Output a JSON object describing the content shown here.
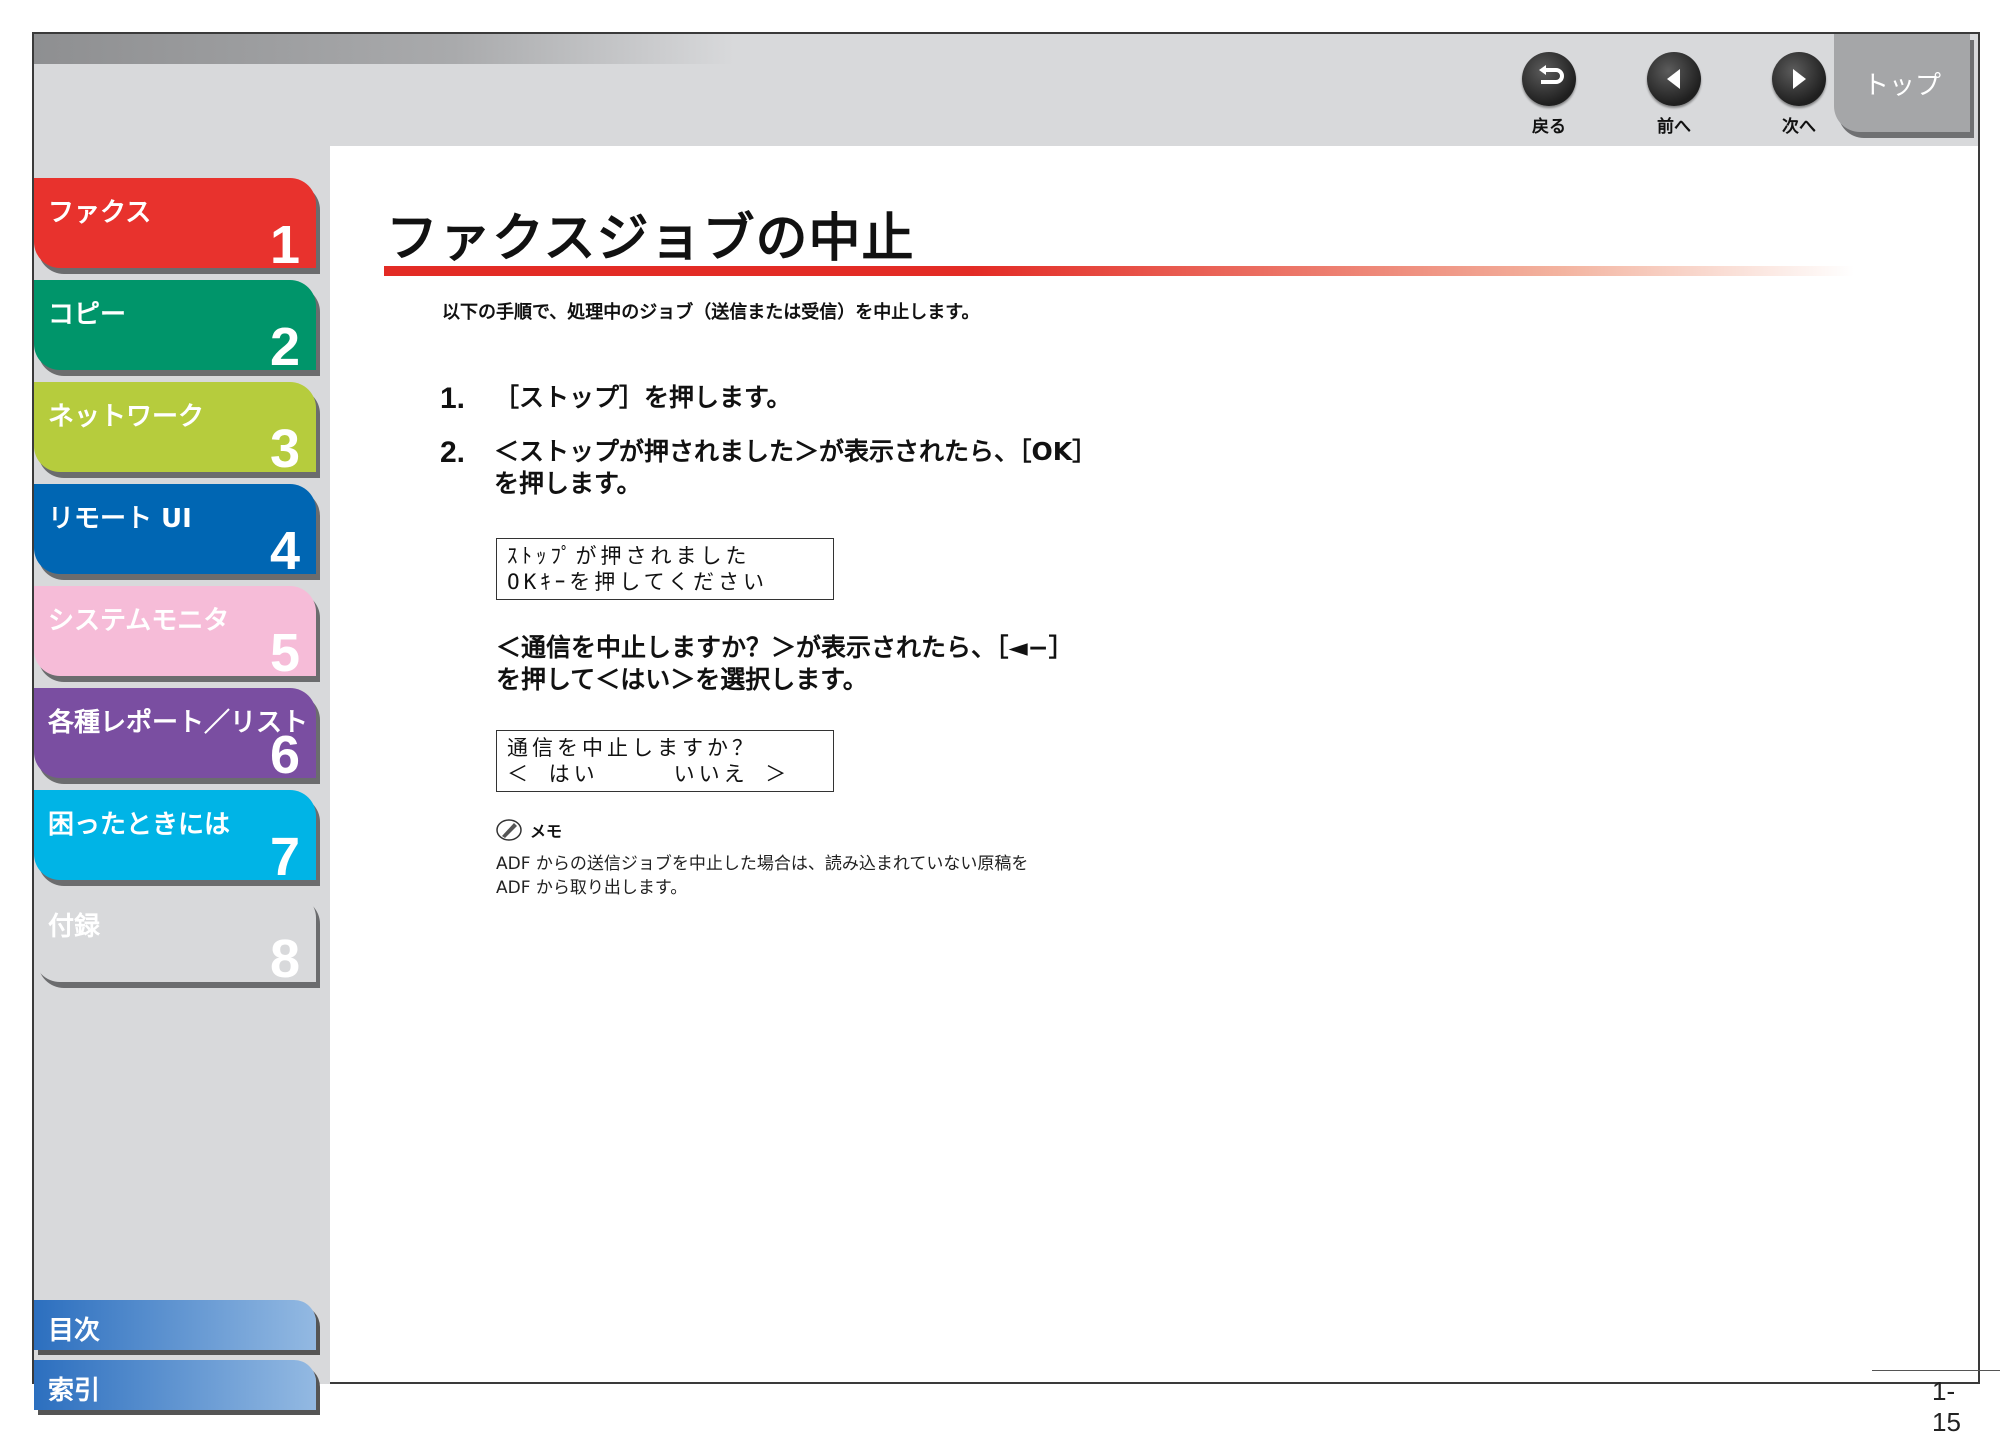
{
  "nav": {
    "back_label": "戻る",
    "prev_label": "前へ",
    "next_label": "次へ",
    "top_label": "トップ"
  },
  "chapters": [
    {
      "title": "ファクス",
      "number": "1",
      "color": "#e8322d"
    },
    {
      "title": "コピー",
      "number": "2",
      "color": "#00956a"
    },
    {
      "title": "ネットワーク",
      "number": "3",
      "color": "#b6cc3d"
    },
    {
      "title": "リモート UI",
      "number": "4",
      "color": "#0066b3"
    },
    {
      "title": "システムモニタ",
      "number": "5",
      "color": "#f6bcd8"
    },
    {
      "title": "各種レポート／リスト",
      "number": "6",
      "color": "#7a4ea1"
    },
    {
      "title": "困ったときには",
      "number": "7",
      "color": "#00b4e6"
    },
    {
      "title": "付録",
      "number": "8",
      "color": "#d8d9db"
    }
  ],
  "sidebar_bottom": {
    "contents_label": "目次",
    "index_label": "索引"
  },
  "page": {
    "title": "ファクスジョブの中止",
    "intro": "以下の手順で、処理中のジョブ（送信または受信）を中止します。",
    "steps": [
      {
        "number": "1.",
        "text": "［ストップ］を押します。"
      },
      {
        "number": "2.",
        "text_line1": "＜ストップが押されました＞が表示されたら、［OK］",
        "text_line2": "を押します。"
      }
    ],
    "lcd1": {
      "line1": "ｽﾄｯﾌﾟが押されました",
      "line2": "OKｷｰを押してください"
    },
    "substep": {
      "line1": "＜通信を中止しますか？＞が表示されたら、［◄−］",
      "line2": "を押して＜はい＞を選択します。"
    },
    "lcd2": {
      "line1": "通信を中止しますか？",
      "line2": "＜ はい　　　いいえ ＞"
    },
    "memo": {
      "heading": "メモ",
      "line1": "ADF からの送信ジョブを中止した場合は、読み込まれていない原稿を",
      "line2": "ADF から取り出します。"
    },
    "page_number": "1-15"
  }
}
